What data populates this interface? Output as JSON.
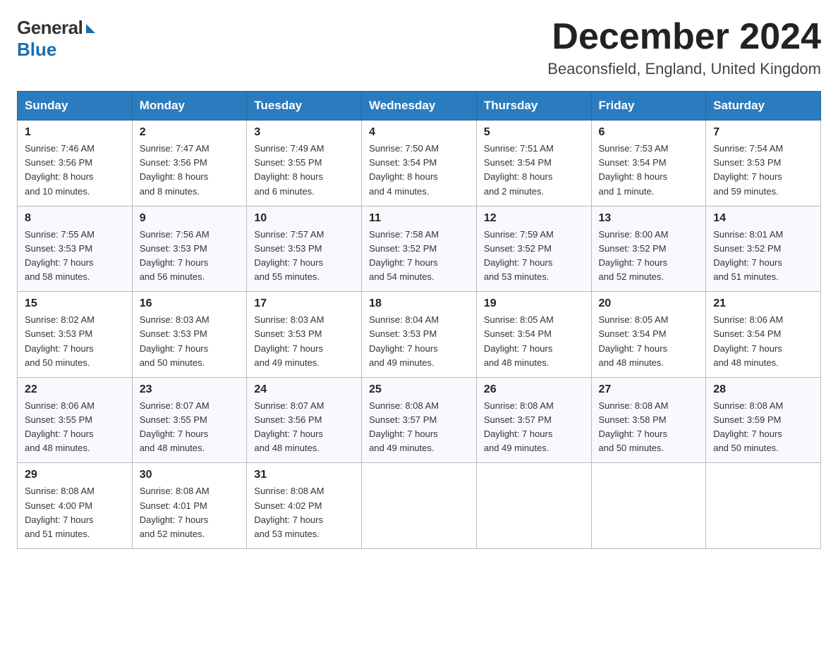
{
  "logo": {
    "general": "General",
    "blue": "Blue"
  },
  "title": "December 2024",
  "subtitle": "Beaconsfield, England, United Kingdom",
  "headers": [
    "Sunday",
    "Monday",
    "Tuesday",
    "Wednesday",
    "Thursday",
    "Friday",
    "Saturday"
  ],
  "weeks": [
    [
      {
        "day": "1",
        "sunrise": "7:46 AM",
        "sunset": "3:56 PM",
        "daylight": "8 hours and 10 minutes."
      },
      {
        "day": "2",
        "sunrise": "7:47 AM",
        "sunset": "3:56 PM",
        "daylight": "8 hours and 8 minutes."
      },
      {
        "day": "3",
        "sunrise": "7:49 AM",
        "sunset": "3:55 PM",
        "daylight": "8 hours and 6 minutes."
      },
      {
        "day": "4",
        "sunrise": "7:50 AM",
        "sunset": "3:54 PM",
        "daylight": "8 hours and 4 minutes."
      },
      {
        "day": "5",
        "sunrise": "7:51 AM",
        "sunset": "3:54 PM",
        "daylight": "8 hours and 2 minutes."
      },
      {
        "day": "6",
        "sunrise": "7:53 AM",
        "sunset": "3:54 PM",
        "daylight": "8 hours and 1 minute."
      },
      {
        "day": "7",
        "sunrise": "7:54 AM",
        "sunset": "3:53 PM",
        "daylight": "7 hours and 59 minutes."
      }
    ],
    [
      {
        "day": "8",
        "sunrise": "7:55 AM",
        "sunset": "3:53 PM",
        "daylight": "7 hours and 58 minutes."
      },
      {
        "day": "9",
        "sunrise": "7:56 AM",
        "sunset": "3:53 PM",
        "daylight": "7 hours and 56 minutes."
      },
      {
        "day": "10",
        "sunrise": "7:57 AM",
        "sunset": "3:53 PM",
        "daylight": "7 hours and 55 minutes."
      },
      {
        "day": "11",
        "sunrise": "7:58 AM",
        "sunset": "3:52 PM",
        "daylight": "7 hours and 54 minutes."
      },
      {
        "day": "12",
        "sunrise": "7:59 AM",
        "sunset": "3:52 PM",
        "daylight": "7 hours and 53 minutes."
      },
      {
        "day": "13",
        "sunrise": "8:00 AM",
        "sunset": "3:52 PM",
        "daylight": "7 hours and 52 minutes."
      },
      {
        "day": "14",
        "sunrise": "8:01 AM",
        "sunset": "3:52 PM",
        "daylight": "7 hours and 51 minutes."
      }
    ],
    [
      {
        "day": "15",
        "sunrise": "8:02 AM",
        "sunset": "3:53 PM",
        "daylight": "7 hours and 50 minutes."
      },
      {
        "day": "16",
        "sunrise": "8:03 AM",
        "sunset": "3:53 PM",
        "daylight": "7 hours and 50 minutes."
      },
      {
        "day": "17",
        "sunrise": "8:03 AM",
        "sunset": "3:53 PM",
        "daylight": "7 hours and 49 minutes."
      },
      {
        "day": "18",
        "sunrise": "8:04 AM",
        "sunset": "3:53 PM",
        "daylight": "7 hours and 49 minutes."
      },
      {
        "day": "19",
        "sunrise": "8:05 AM",
        "sunset": "3:54 PM",
        "daylight": "7 hours and 48 minutes."
      },
      {
        "day": "20",
        "sunrise": "8:05 AM",
        "sunset": "3:54 PM",
        "daylight": "7 hours and 48 minutes."
      },
      {
        "day": "21",
        "sunrise": "8:06 AM",
        "sunset": "3:54 PM",
        "daylight": "7 hours and 48 minutes."
      }
    ],
    [
      {
        "day": "22",
        "sunrise": "8:06 AM",
        "sunset": "3:55 PM",
        "daylight": "7 hours and 48 minutes."
      },
      {
        "day": "23",
        "sunrise": "8:07 AM",
        "sunset": "3:55 PM",
        "daylight": "7 hours and 48 minutes."
      },
      {
        "day": "24",
        "sunrise": "8:07 AM",
        "sunset": "3:56 PM",
        "daylight": "7 hours and 48 minutes."
      },
      {
        "day": "25",
        "sunrise": "8:08 AM",
        "sunset": "3:57 PM",
        "daylight": "7 hours and 49 minutes."
      },
      {
        "day": "26",
        "sunrise": "8:08 AM",
        "sunset": "3:57 PM",
        "daylight": "7 hours and 49 minutes."
      },
      {
        "day": "27",
        "sunrise": "8:08 AM",
        "sunset": "3:58 PM",
        "daylight": "7 hours and 50 minutes."
      },
      {
        "day": "28",
        "sunrise": "8:08 AM",
        "sunset": "3:59 PM",
        "daylight": "7 hours and 50 minutes."
      }
    ],
    [
      {
        "day": "29",
        "sunrise": "8:08 AM",
        "sunset": "4:00 PM",
        "daylight": "7 hours and 51 minutes."
      },
      {
        "day": "30",
        "sunrise": "8:08 AM",
        "sunset": "4:01 PM",
        "daylight": "7 hours and 52 minutes."
      },
      {
        "day": "31",
        "sunrise": "8:08 AM",
        "sunset": "4:02 PM",
        "daylight": "7 hours and 53 minutes."
      },
      null,
      null,
      null,
      null
    ]
  ],
  "labels": {
    "sunrise": "Sunrise:",
    "sunset": "Sunset:",
    "daylight": "Daylight:"
  }
}
